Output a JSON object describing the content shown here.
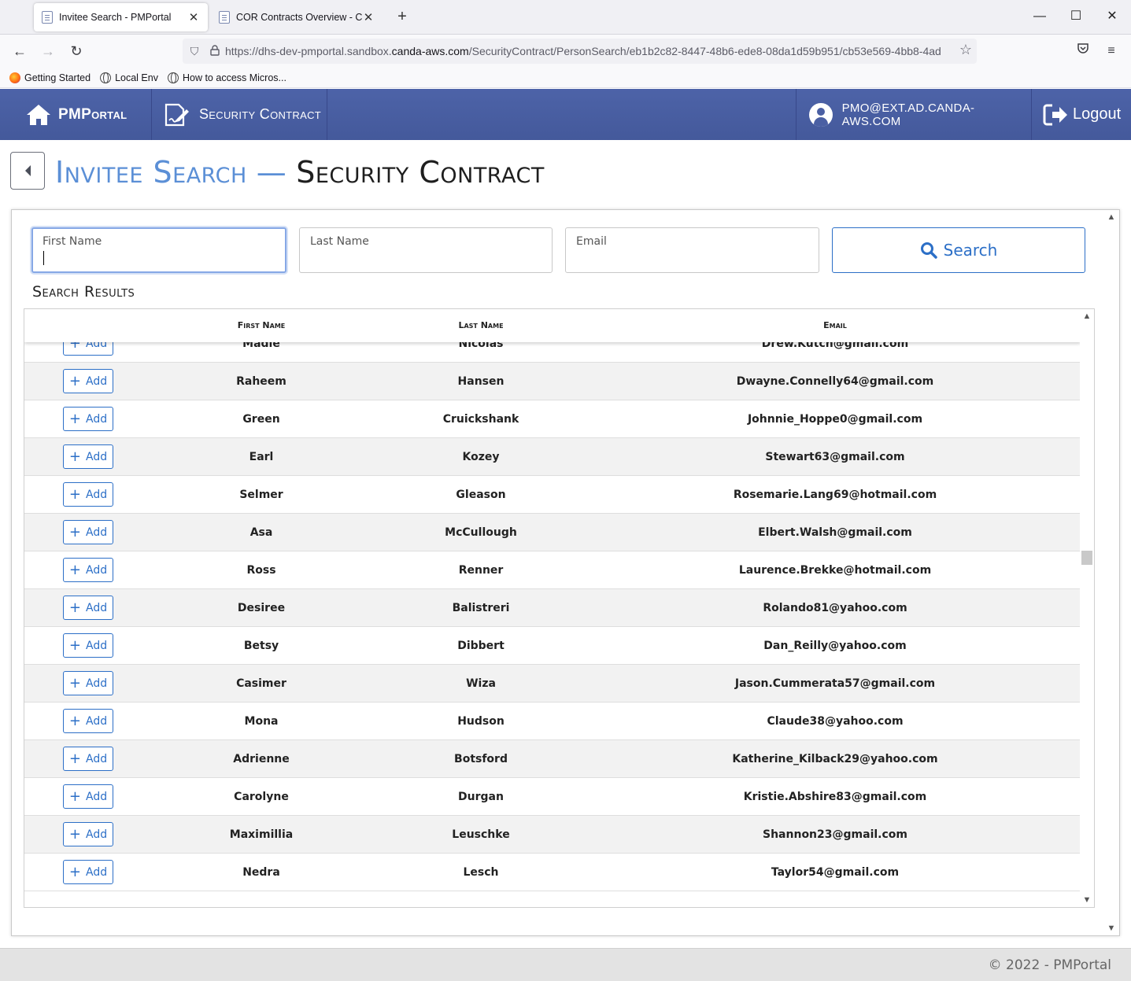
{
  "browser": {
    "tabs": [
      {
        "title": "Invitee Search - PMPortal",
        "active": true
      },
      {
        "title": "COR Contracts Overview - CorP",
        "active": false
      }
    ],
    "url_prefix": "https://dhs-dev-pmportal.sandbox.",
    "url_domain": "canda-aws.com",
    "url_path": "/SecurityContract/PersonSearch/eb1b2c82-8447-48b6-ede8-08da1d59b951/cb53e569-4bb8-4ad",
    "bookmarks": [
      "Getting Started",
      "Local Env",
      "How to access Micros..."
    ]
  },
  "header": {
    "brand": "PMPortal",
    "section": "Security Contract",
    "user": "PMO@EXT.AD.CANDA-AWS.COM",
    "logout": "Logout"
  },
  "page": {
    "title_part1": "Invitee Search",
    "title_sep": "—",
    "title_part2": "Security Contract"
  },
  "search": {
    "first_name_label": "First Name",
    "last_name_label": "Last Name",
    "email_label": "Email",
    "first_name_value": "",
    "last_name_value": "",
    "email_value": "",
    "button_label": "Search"
  },
  "results": {
    "heading": "Search Results",
    "columns": [
      "First Name",
      "Last Name",
      "Email"
    ],
    "add_label": "Add",
    "rows": [
      {
        "first": "Madie",
        "last": "Nicolas",
        "email": "Drew.Kutch@gmail.com"
      },
      {
        "first": "Raheem",
        "last": "Hansen",
        "email": "Dwayne.Connelly64@gmail.com"
      },
      {
        "first": "Green",
        "last": "Cruickshank",
        "email": "Johnnie_Hoppe0@gmail.com"
      },
      {
        "first": "Earl",
        "last": "Kozey",
        "email": "Stewart63@gmail.com"
      },
      {
        "first": "Selmer",
        "last": "Gleason",
        "email": "Rosemarie.Lang69@hotmail.com"
      },
      {
        "first": "Asa",
        "last": "McCullough",
        "email": "Elbert.Walsh@gmail.com"
      },
      {
        "first": "Ross",
        "last": "Renner",
        "email": "Laurence.Brekke@hotmail.com"
      },
      {
        "first": "Desiree",
        "last": "Balistreri",
        "email": "Rolando81@yahoo.com"
      },
      {
        "first": "Betsy",
        "last": "Dibbert",
        "email": "Dan_Reilly@yahoo.com"
      },
      {
        "first": "Casimer",
        "last": "Wiza",
        "email": "Jason.Cummerata57@gmail.com"
      },
      {
        "first": "Mona",
        "last": "Hudson",
        "email": "Claude38@yahoo.com"
      },
      {
        "first": "Adrienne",
        "last": "Botsford",
        "email": "Katherine_Kilback29@yahoo.com"
      },
      {
        "first": "Carolyne",
        "last": "Durgan",
        "email": "Kristie.Abshire83@gmail.com"
      },
      {
        "first": "Maximillia",
        "last": "Leuschke",
        "email": "Shannon23@gmail.com"
      },
      {
        "first": "Nedra",
        "last": "Lesch",
        "email": "Taylor54@gmail.com"
      }
    ]
  },
  "footer": {
    "copyright": "© 2022 - PMPortal"
  },
  "colors": {
    "header_bg": "#4a5fa3",
    "accent": "#2c6fc7",
    "title_accent": "#5b8fd6"
  }
}
